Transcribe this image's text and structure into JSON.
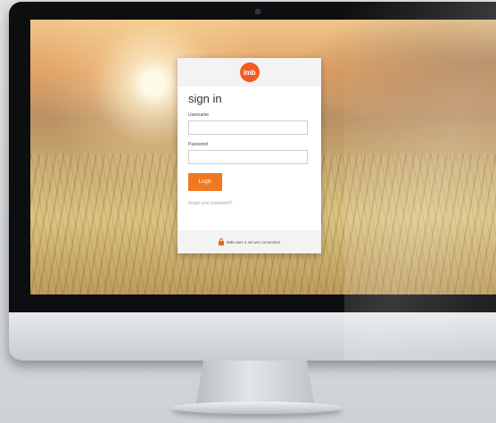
{
  "logo": {
    "text": "imb"
  },
  "login": {
    "title": "sign in",
    "username_label": "Username",
    "username_value": "",
    "password_label": "Password",
    "password_value": "",
    "button_label": "Login",
    "forgot_link": "forgot your password?",
    "secure_note": "IMB uses a secure connection"
  },
  "colors": {
    "accent": "#f0781e",
    "logo": "#f15a24",
    "card_header": "#f3f3f3"
  }
}
